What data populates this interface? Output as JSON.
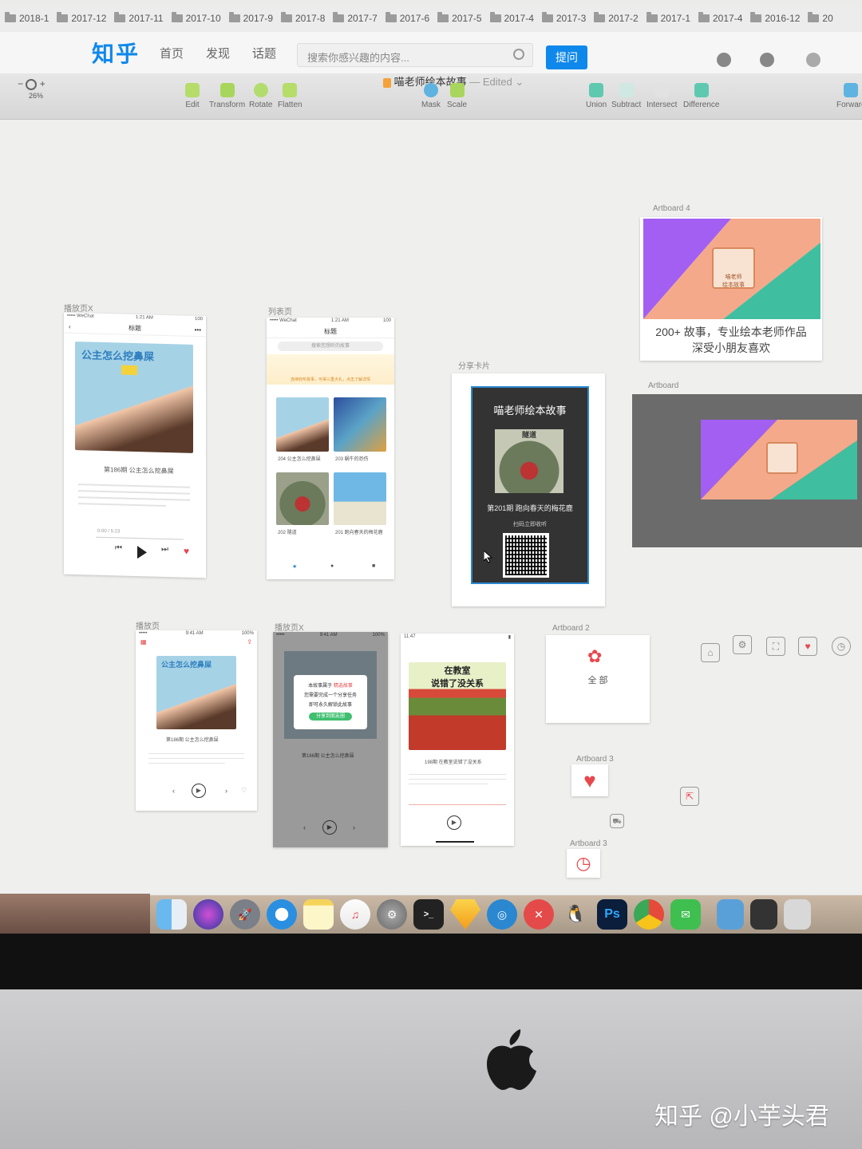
{
  "bookmarks": [
    "2018-1",
    "2017-12",
    "2017-11",
    "2017-10",
    "2017-9",
    "2017-8",
    "2017-7",
    "2017-6",
    "2017-5",
    "2017-4",
    "2017-3",
    "2017-2",
    "2017-1",
    "2017-4",
    "2016-12",
    "20"
  ],
  "zhihu": {
    "logo": "知乎",
    "nav": [
      "首页",
      "发现",
      "话题"
    ],
    "search_placeholder": "搜索你感兴趣的内容...",
    "ask_label": "提问"
  },
  "toolbar": {
    "zoom_level": "26%",
    "zoom_minus": "−",
    "zoom_plus": "+",
    "document_title": "喵老师绘本故事",
    "document_status": "— Edited",
    "tools_left": [
      "Edit",
      "Transform",
      "Rotate",
      "Flatten"
    ],
    "tools_mid": [
      "Mask",
      "Scale"
    ],
    "tools_bool": [
      "Union",
      "Subtract",
      "Intersect",
      "Difference"
    ],
    "tool_right": "Forward"
  },
  "artboards": {
    "play_x": "播放页X",
    "list": "列表页",
    "share": "分享卡片",
    "ab4": "Artboard 4",
    "ab": "Artboard",
    "play": "播放页",
    "play_x2": "播放页X",
    "ab2": "Artboard 2",
    "ab3a": "Artboard 3",
    "ab3b": "Artboard 3"
  },
  "play_screen": {
    "status_left": "••••• WeChat",
    "status_time": "1:21 AM",
    "status_right": "100",
    "nav_title": "标题",
    "cover_title": "公主怎么挖鼻屎",
    "episode": "第186期  公主怎么挖鼻屎",
    "time": "0:00 / 5:23"
  },
  "list_screen": {
    "status_left": "••••• WeChat",
    "status_time": "1:21 AM",
    "status_right": "100",
    "nav_title": "标题",
    "search_placeholder": "搜索您想听的故事",
    "notice": "连续收听故事，可得三重大礼，点击了解详情",
    "items": [
      "204 公主怎么挖鼻屎",
      "203 蜗牛的恐伤",
      "202 隧道",
      "201 跑向春天的梅花鹿"
    ]
  },
  "share_card": {
    "title": "喵老师绘本故事",
    "cover_text": "隧道",
    "episode": "第201期  跑向春天的梅花鹿",
    "scan_text": "扫码立即收听"
  },
  "ab4_banner": {
    "badge": "喵老师\n绘本故事",
    "caption_line1": "200+ 故事，专业绘本老师作品",
    "caption_line2": "深受小朋友喜欢"
  },
  "play2": {
    "status_time": "9:41 AM",
    "status_right": "100%",
    "cover_title": "公主怎么挖鼻屎",
    "episode": "第186期  公主怎么挖鼻屎"
  },
  "play_x2_screen": {
    "status_time": "9:41 AM",
    "status_right": "100%",
    "modal_line1_prefix": "本故事属于",
    "modal_line1_accent": "精选故事",
    "modal_line2": "您需要完成一个分享任务",
    "modal_line3": "即可永久解锁此故事",
    "modal_button": "分享到朋友圈",
    "episode": "第166期  公主怎么挖鼻屎"
  },
  "play3": {
    "status_time": "11:47",
    "cover_line1": "在教室",
    "cover_line2": "说错了没关系",
    "episode": "198期  在教室说错了没关系"
  },
  "ab2": {
    "label": "全 部"
  },
  "dock": [
    "Finder",
    "Siri",
    "Launchpad",
    "Safari",
    "Notes",
    "Music",
    "Settings",
    "Terminal",
    "Sketch",
    "Pocket",
    "X",
    "QQ",
    "Ps",
    "Chrome",
    "WeChat"
  ],
  "watermark": "知乎 @小芋头君",
  "colors": {
    "zhihu_blue": "#0f88eb",
    "accent_red": "#e8474c",
    "banner_purple": "#a25ff2",
    "banner_peach": "#f4a98a",
    "banner_teal": "#3fbf9f",
    "share_border": "#2a87d0"
  }
}
